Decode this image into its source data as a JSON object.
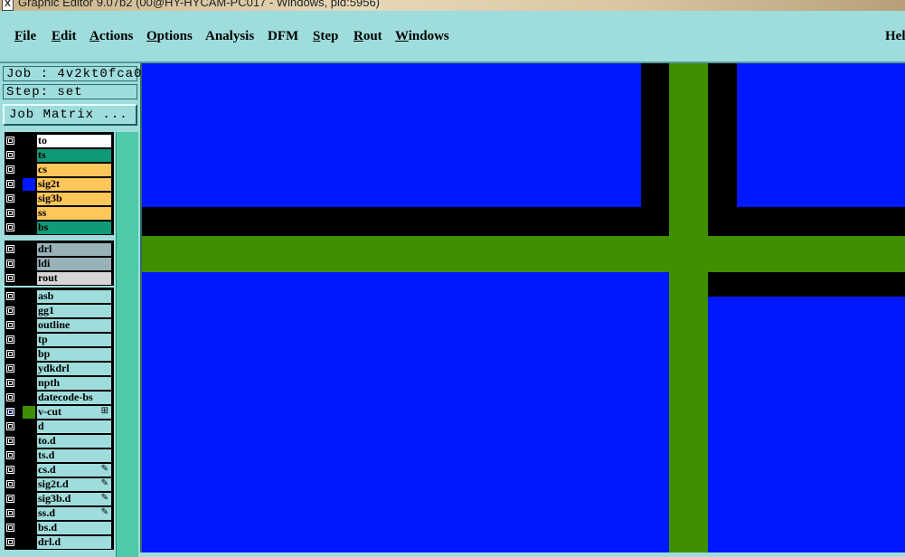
{
  "window": {
    "title": "Graphic Editor 9.07b2 (00@HY-HYCAM-PC017 - Windows, pid:5956)",
    "icon": "x-icon"
  },
  "menubar": {
    "items": [
      {
        "key": "F",
        "rest": "ile"
      },
      {
        "key": "E",
        "rest": "dit"
      },
      {
        "key": "A",
        "rest": "ctions"
      },
      {
        "key": "O",
        "rest": "ptions"
      },
      {
        "key": "",
        "rest": "Analysis"
      },
      {
        "key": "",
        "rest": "DFM"
      },
      {
        "key": "S",
        "rest": "tep"
      },
      {
        "key": "R",
        "rest": "out"
      },
      {
        "key": "W",
        "rest": "indows"
      },
      {
        "key": "",
        "rest": "Hel"
      }
    ]
  },
  "job": {
    "job_line": "Job : 4v2kt0fca0",
    "step_line": "Step: set",
    "matrix_button": "Job Matrix ..."
  },
  "layers": {
    "board": [
      {
        "name": "to",
        "color": "#ffffff",
        "swatch": ""
      },
      {
        "name": "ts",
        "color": "#119a77",
        "swatch": ""
      },
      {
        "name": "cs",
        "color": "#ffc65a",
        "swatch": ""
      },
      {
        "name": "sig2t",
        "color": "#ffc65a",
        "swatch": "#0018ff"
      },
      {
        "name": "sig3b",
        "color": "#ffc65a",
        "swatch": ""
      },
      {
        "name": "ss",
        "color": "#ffc65a",
        "swatch": ""
      },
      {
        "name": "bs",
        "color": "#119a77",
        "swatch": ""
      }
    ],
    "drill": [
      {
        "name": "drl",
        "color": "#98b2b8",
        "swatch": ""
      },
      {
        "name": "ldi",
        "color": "#98b2b8",
        "swatch": ""
      },
      {
        "name": "rout",
        "color": "#d6d6d6",
        "swatch": ""
      }
    ],
    "misc": [
      {
        "name": "asb",
        "color": "#9fdcdc",
        "swatch": "",
        "mark": ""
      },
      {
        "name": "gg1",
        "color": "#9fdcdc",
        "swatch": "",
        "mark": ""
      },
      {
        "name": "outline",
        "color": "#9fdcdc",
        "swatch": "",
        "mark": ""
      },
      {
        "name": "tp",
        "color": "#9fdcdc",
        "swatch": "",
        "mark": ""
      },
      {
        "name": "bp",
        "color": "#9fdcdc",
        "swatch": "",
        "mark": ""
      },
      {
        "name": "ydkdrl",
        "color": "#9fdcdc",
        "swatch": "",
        "mark": ""
      },
      {
        "name": "npth",
        "color": "#9fdcdc",
        "swatch": "",
        "mark": ""
      },
      {
        "name": "datecode-bs",
        "color": "#9fdcdc",
        "swatch": "",
        "mark": ""
      },
      {
        "name": "v-cut",
        "color": "#9fdcdc",
        "swatch": "#3f8f00",
        "mark": "⊞",
        "active": true
      },
      {
        "name": "d",
        "color": "#9fdcdc",
        "swatch": "",
        "mark": ""
      },
      {
        "name": "to.d",
        "color": "#9fdcdc",
        "swatch": "",
        "mark": ""
      },
      {
        "name": "ts.d",
        "color": "#9fdcdc",
        "swatch": "",
        "mark": ""
      },
      {
        "name": "cs.d",
        "color": "#9fdcdc",
        "swatch": "",
        "mark": "✎"
      },
      {
        "name": "sig2t.d",
        "color": "#9fdcdc",
        "swatch": "",
        "mark": "✎"
      },
      {
        "name": "sig3b.d",
        "color": "#9fdcdc",
        "swatch": "",
        "mark": "✎"
      },
      {
        "name": "ss.d",
        "color": "#9fdcdc",
        "swatch": "",
        "mark": "✎"
      },
      {
        "name": "bs.d",
        "color": "#9fdcdc",
        "swatch": "",
        "mark": ""
      },
      {
        "name": "drl.d",
        "color": "#9fdcdc",
        "swatch": "",
        "mark": ""
      }
    ]
  },
  "colors": {
    "canvas_blue": "#0018ff",
    "vcut_green": "#3f8f00",
    "background_black": "#000000",
    "panel": "#9fdcdc"
  }
}
